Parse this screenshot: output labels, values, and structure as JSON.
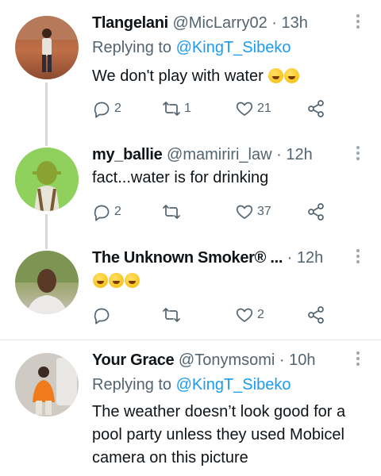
{
  "tweets": [
    {
      "name": "Tlangelani",
      "handle": "@MicLarry02",
      "time": "13h",
      "replying_label": "Replying to",
      "replying_mention": "@KingT_Sibeko",
      "text": "We don't play with water",
      "emoji": [
        "face-with-tears-of-joy",
        "rolling-on-floor-laughing"
      ],
      "replies": "2",
      "retweets": "1",
      "likes": "21"
    },
    {
      "name": "my_ballie",
      "handle": "@mamiriri_law",
      "time": "12h",
      "text": "fact...water is for drinking",
      "replies": "2",
      "retweets": "",
      "likes": "37"
    },
    {
      "name": "The Unknown Smoker® ...",
      "handle": "",
      "time": "12h",
      "text": "",
      "emoji": [
        "rolling-on-floor-laughing",
        "rolling-on-floor-laughing",
        "rolling-on-floor-laughing"
      ],
      "replies": "",
      "retweets": "",
      "likes": "2"
    },
    {
      "name": "Your Grace",
      "handle": "@Tonymsomi",
      "time": "10h",
      "replying_label": "Replying to",
      "replying_mention": "@KingT_Sibeko",
      "text": "The weather doesn’t look good for a pool party unless they used Mobicel camera on this picture"
    }
  ],
  "separator": "·",
  "icons": {
    "reply": "reply-bubble-icon",
    "retweet": "retweet-icon",
    "like": "heart-icon",
    "share": "share-icon",
    "more": "more-vertical-icon"
  },
  "colors": {
    "name": "#0f1419",
    "meta": "#536471",
    "link": "#1d9bf0",
    "thread_line": "#cfd9de",
    "icon": "#536471"
  }
}
